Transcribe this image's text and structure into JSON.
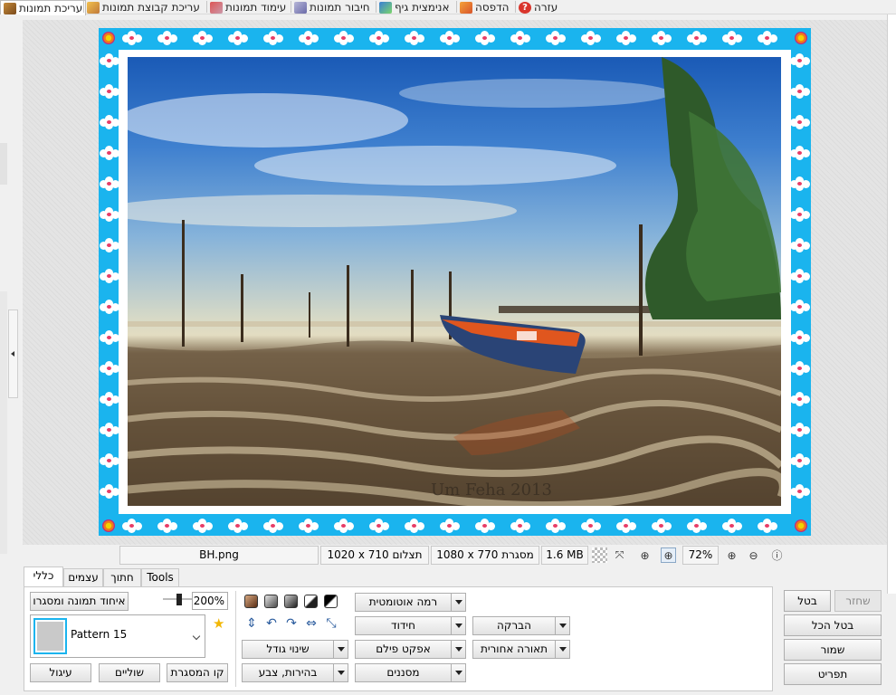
{
  "top_tabs": [
    {
      "label": "עריכת תמונות",
      "icon": "photo-edit-icon",
      "active": true
    },
    {
      "label": "עריכת קבוצת תמונות",
      "icon": "batch-edit-icon",
      "active": false
    },
    {
      "label": "עימוד תמונות",
      "icon": "layout-icon",
      "active": false
    },
    {
      "label": "חיבור תמונות",
      "icon": "combine-icon",
      "active": false
    },
    {
      "label": "אנימצית גיף",
      "icon": "gif-animation-icon",
      "active": false
    },
    {
      "label": "הדפסה",
      "icon": "print-icon",
      "active": false
    },
    {
      "label": "עזרה",
      "icon": "help-icon",
      "active": false
    }
  ],
  "image": {
    "watermark": "Um Feha 2013"
  },
  "status": {
    "filename": "BH.png",
    "photo_size": "1020 x 710 תצלום",
    "frame_size": "1080 x 770 מסגרת",
    "file_size": "1.6 MB",
    "zoom": "72%"
  },
  "bottom_tabs": [
    {
      "label": "כללי",
      "active": true
    },
    {
      "label": "עצמים",
      "active": false
    },
    {
      "label": "חתוך",
      "active": false
    },
    {
      "label": "Tools",
      "active": false
    }
  ],
  "panel": {
    "unite_button": "איחוד תמונה ומסגרו",
    "zoom_value": "200%",
    "pattern_label": "Pattern 15",
    "frame_line_button": "קו המסגרת",
    "margins_button": "שוליים",
    "rounding_button": "עיגול",
    "resize_button": "שינוי גודל",
    "brightness_button": "בהירות, צבע",
    "auto_level_button": "רמה אוטומטית",
    "sharpen_button": "חידוד",
    "film_effect_button": "אפקט פילם",
    "filters_button": "מסננים",
    "gloss_button": "הברקה",
    "backlight_button": "תאורה אחורית"
  },
  "actions": {
    "restore": "שחזר",
    "cancel": "בטל",
    "cancel_all": "בטל הכל",
    "save": "שמור",
    "menu": "תפריט"
  },
  "colors": {
    "frame_blue": "#1ab4ee",
    "flower_pink": "#e83d66"
  }
}
